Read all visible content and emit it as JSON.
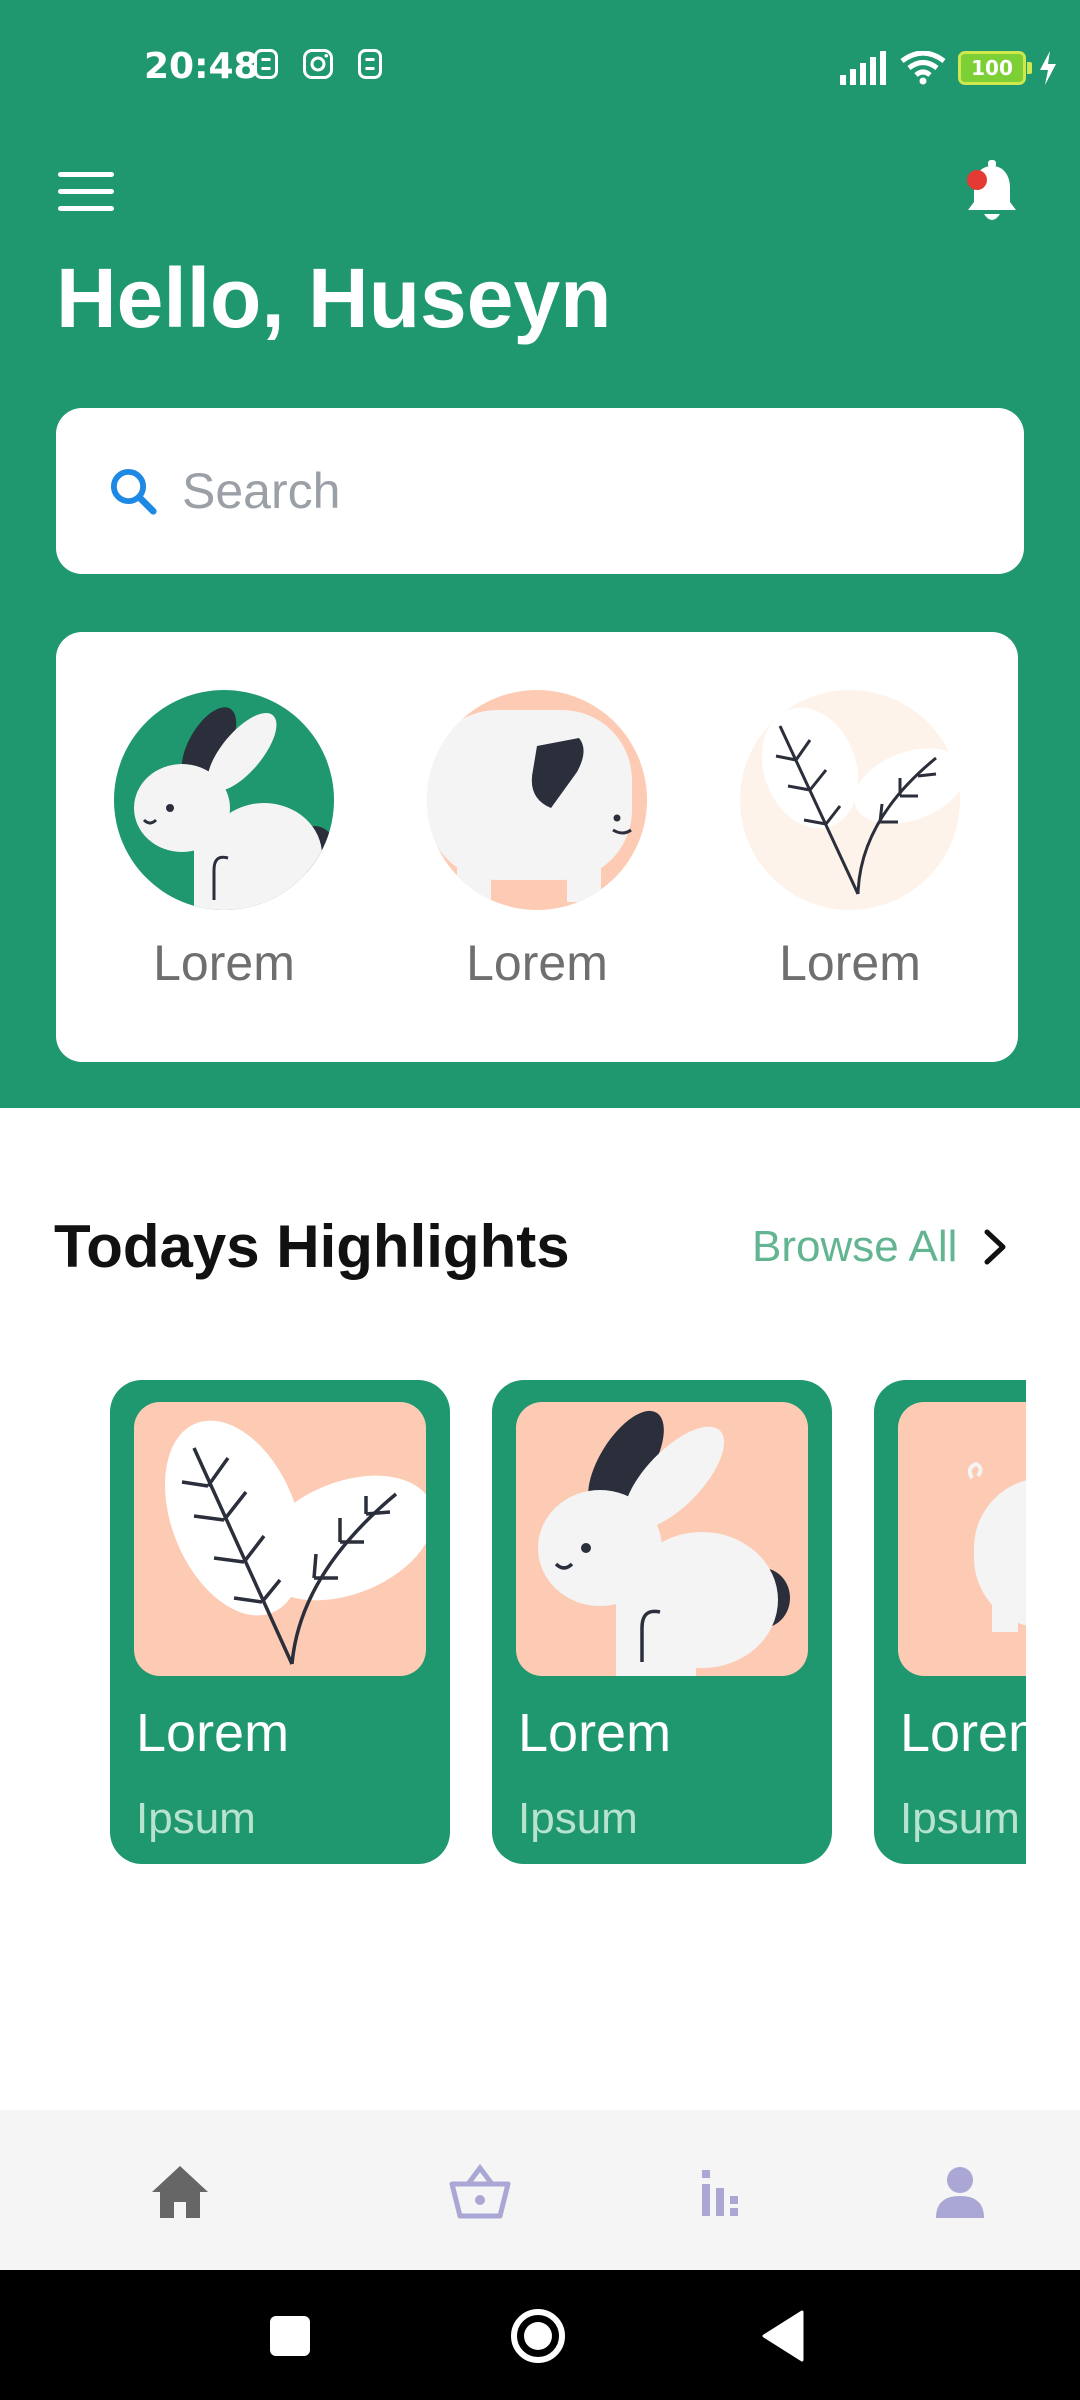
{
  "status_bar": {
    "time": "20:48",
    "battery": "100",
    "icons": [
      "notification-icon",
      "instagram-icon",
      "notification-icon",
      "signal-icon",
      "wifi-icon",
      "battery-icon",
      "charging-icon"
    ]
  },
  "header": {
    "greeting": "Hello, Huseyn",
    "menu_icon": "hamburger-menu-icon",
    "bell_icon": "bell-icon"
  },
  "search": {
    "placeholder": "Search"
  },
  "categories": [
    {
      "label": "Lorem",
      "image": "rabbit"
    },
    {
      "label": "Lorem",
      "image": "pig"
    },
    {
      "label": "Lorem",
      "image": "plant"
    }
  ],
  "highlights": {
    "title": "Todays Highlights",
    "browse_label": "Browse All",
    "items": [
      {
        "title": "Lorem",
        "subtitle": "Ipsum",
        "image": "plant"
      },
      {
        "title": "Lorem",
        "subtitle": "Ipsum",
        "image": "rabbit"
      },
      {
        "title": "Lorem",
        "subtitle": "Ipsum",
        "image": "pig"
      }
    ]
  },
  "bottom_nav": [
    {
      "icon": "home-icon",
      "active": true
    },
    {
      "icon": "basket-icon",
      "active": false
    },
    {
      "icon": "stats-icon",
      "active": false
    },
    {
      "icon": "profile-icon",
      "active": false
    }
  ],
  "colors": {
    "primary": "#1f976f",
    "peach": "#fdcbb3",
    "browse_text": "#63b592"
  }
}
